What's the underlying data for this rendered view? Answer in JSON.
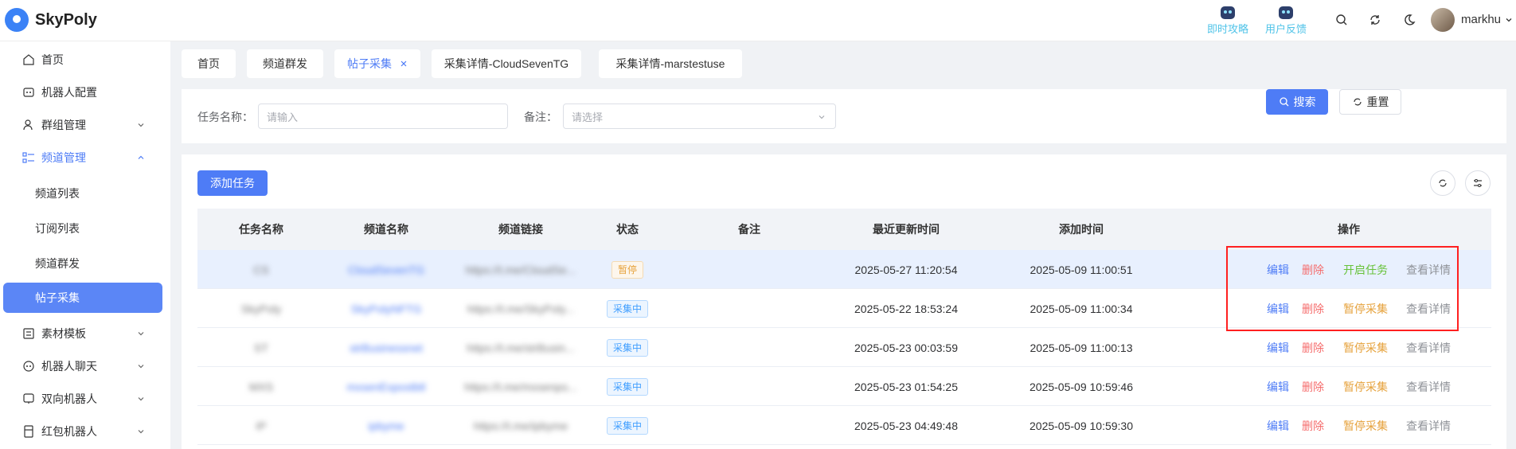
{
  "brand": {
    "name": "SkyPoly",
    "accent": "#4e7cf6"
  },
  "header": {
    "links": [
      {
        "label": "即时攻略"
      },
      {
        "label": "用户反馈"
      }
    ],
    "icons": [
      "search-icon",
      "refresh-icon",
      "moon-icon"
    ],
    "user": {
      "name": "markhu"
    }
  },
  "sidebar": {
    "items": [
      {
        "label": "首页",
        "icon": "home-icon"
      },
      {
        "label": "机器人配置",
        "icon": "robot-icon"
      },
      {
        "label": "群组管理",
        "icon": "users-icon",
        "caret": "down"
      },
      {
        "label": "频道管理",
        "icon": "list-icon",
        "caret": "up",
        "state": "open"
      },
      {
        "label": "频道列表",
        "sub": true
      },
      {
        "label": "订阅列表",
        "sub": true
      },
      {
        "label": "频道群发",
        "sub": true
      },
      {
        "label": "帖子采集",
        "sub": true,
        "state": "active"
      },
      {
        "label": "素材模板",
        "icon": "template-icon",
        "caret": "down"
      },
      {
        "label": "机器人聊天",
        "icon": "chat-bot-icon",
        "caret": "down"
      },
      {
        "label": "双向机器人",
        "icon": "two-way-bot-icon",
        "caret": "down"
      },
      {
        "label": "红包机器人",
        "icon": "red-packet-icon",
        "caret": "down"
      }
    ]
  },
  "tabs": [
    {
      "label": "首页"
    },
    {
      "label": "频道群发"
    },
    {
      "label": "帖子采集",
      "active": true,
      "closable": true
    },
    {
      "label": "采集详情-CloudSevenTG"
    },
    {
      "label": "采集详情-marstestuse"
    }
  ],
  "search": {
    "task_label": "任务名称：",
    "task_placeholder": "请输入",
    "remark_label": "备注：",
    "remark_placeholder": "请选择",
    "search_button": "搜索",
    "reset_button": "重置"
  },
  "toolbar": {
    "add_button": "添加任务"
  },
  "table": {
    "columns": [
      "任务名称",
      "频道名称",
      "频道链接",
      "状态",
      "备注",
      "最近更新时间",
      "添加时间",
      "操作"
    ],
    "rows": [
      {
        "task": "CS",
        "channel": "CloudSevenTG",
        "link": "https://t.me/CloudSe...",
        "status": "暂停",
        "status_type": "paused",
        "remark": "",
        "updated": "2025-05-27 11:20:54",
        "added": "2025-05-09 11:00:51",
        "toggle": "开启任务",
        "toggle_type": "start"
      },
      {
        "task": "SkyPoly",
        "channel": "SkyPolyNFTG",
        "link": "https://t.me/SkyPoly...",
        "status": "采集中",
        "status_type": "running",
        "remark": "",
        "updated": "2025-05-22 18:53:24",
        "added": "2025-05-09 11:00:34",
        "toggle": "暂停采集",
        "toggle_type": "pause"
      },
      {
        "task": "ST",
        "channel": "strBusinessnet",
        "link": "https://t.me/strBusin...",
        "status": "采集中",
        "status_type": "running",
        "remark": "",
        "updated": "2025-05-23 00:03:59",
        "added": "2025-05-09 11:00:13",
        "toggle": "暂停采集",
        "toggle_type": "pause"
      },
      {
        "task": "MXS",
        "channel": "mxsenExpostbtl",
        "link": "https://t.me/mxsenpo...",
        "status": "采集中",
        "status_type": "running",
        "remark": "",
        "updated": "2025-05-23 01:54:25",
        "added": "2025-05-09 10:59:46",
        "toggle": "暂停采集",
        "toggle_type": "pause"
      },
      {
        "task": "IP",
        "channel": "ipbyme",
        "link": "https://t.me/ipbyme",
        "status": "采集中",
        "status_type": "running",
        "remark": "",
        "updated": "2025-05-23 04:49:48",
        "added": "2025-05-09 10:59:30",
        "toggle": "暂停采集",
        "toggle_type": "pause"
      }
    ],
    "actions": {
      "edit": "编辑",
      "delete": "删除",
      "view": "查看详情"
    }
  }
}
